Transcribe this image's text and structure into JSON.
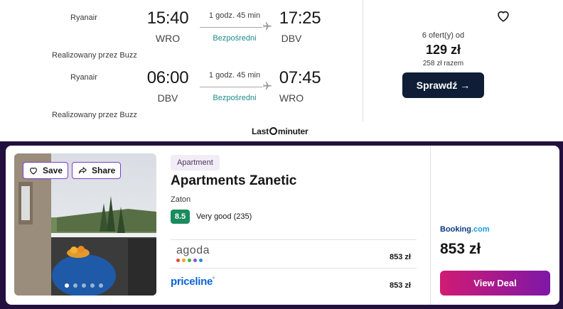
{
  "flight": {
    "legs": [
      {
        "airline": "Ryanair",
        "depart_time": "15:40",
        "arrive_time": "17:25",
        "depart_code": "WRO",
        "arrive_code": "DBV",
        "duration": "1 godz. 45 min",
        "stops": "Bezpośredni",
        "operated_by": "Realizowany przez Buzz"
      },
      {
        "airline": "Ryanair",
        "depart_time": "06:00",
        "arrive_time": "07:45",
        "depart_code": "DBV",
        "arrive_code": "WRO",
        "duration": "1 godz. 45 min",
        "stops": "Bezpośredni",
        "operated_by": "Realizowany przez Buzz"
      }
    ],
    "offers_label": "6 ofert(y) od",
    "price": "129 zł",
    "total": "258 zł razem",
    "check_button": "Sprawdź →",
    "provider_logo_pre": "Last",
    "provider_logo_post": "minuter"
  },
  "hotel": {
    "save_label": "Save",
    "share_label": "Share",
    "type": "Apartment",
    "name": "Apartments Zanetic",
    "location": "Zaton",
    "score": "8.5",
    "score_text": "Very good (235)",
    "providers": [
      {
        "name": "agoda",
        "price": "853 zł"
      },
      {
        "name": "priceline",
        "price": "853 zł"
      }
    ],
    "featured_provider_pre": "Booking",
    "featured_provider_post": ".com",
    "featured_price": "853 zł",
    "deal_button": "View Deal",
    "photo_count_dots": 5,
    "active_photo": 1
  },
  "colors": {
    "teal": "#1e8a8a",
    "navy_button": "#0f1d36",
    "hotel_bg": "#23103f",
    "score_green": "#1b8b5d",
    "deal_gradient_start": "#d11b74",
    "deal_gradient_end": "#7e17a6",
    "agoda_dots": [
      "#e8443a",
      "#f0a420",
      "#3bb54a",
      "#8e4fcf",
      "#2a8bd8"
    ]
  }
}
